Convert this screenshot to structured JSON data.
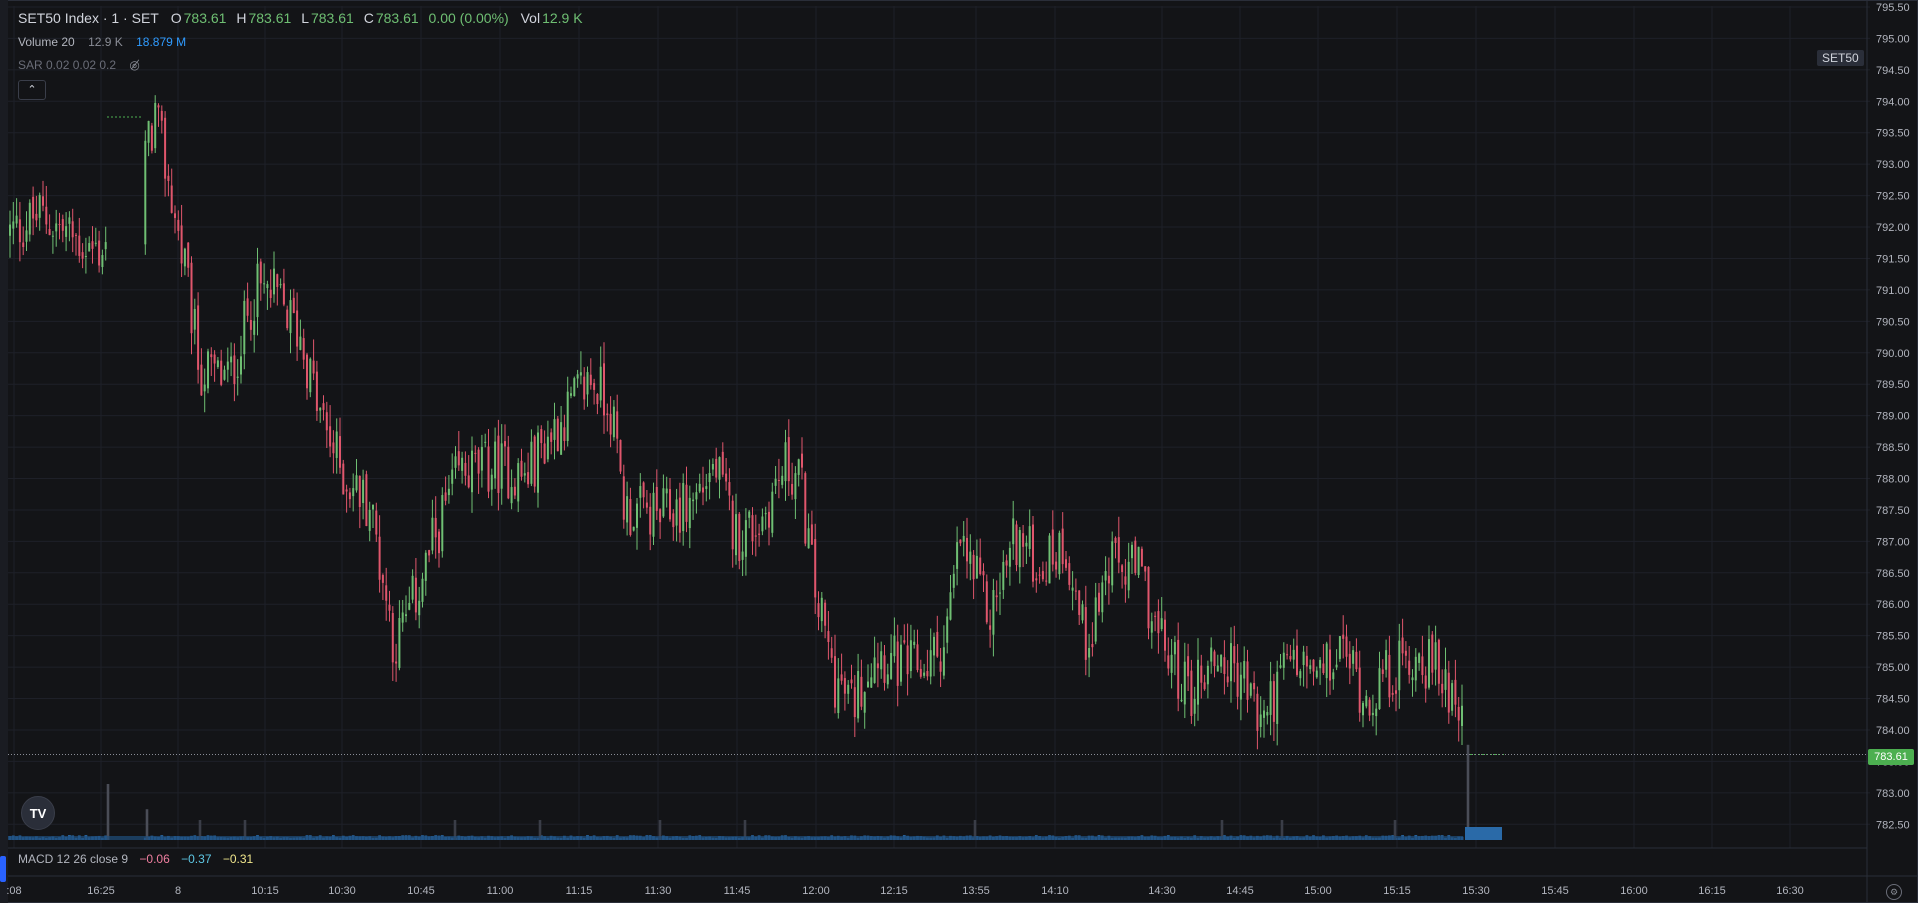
{
  "header": {
    "symbol": "SET50 Index · 1 · SET",
    "open_label": "O",
    "open": "783.61",
    "high_label": "H",
    "high": "783.61",
    "low_label": "L",
    "low": "783.61",
    "close_label": "C",
    "close": "783.61",
    "change": "0.00 (0.00%)",
    "vol_label": "Vol",
    "vol": "12.9 K"
  },
  "volume_legend": {
    "label": "Volume 20",
    "value": "12.9 K",
    "sma": "18.879 M"
  },
  "sar_legend": {
    "label": "SAR 0.02 0.02 0.2"
  },
  "macd_legend": {
    "label": "MACD 12 26 close 9",
    "macd": "−0.06",
    "signal": "−0.37",
    "hist": "−0.31"
  },
  "symbol_tag": "SET50",
  "last_price": "783.61",
  "icons": {
    "collapse": "chevron-up-icon",
    "logo": "tradingview-logo-icon",
    "eye": "eye-off-icon",
    "settings": "settings-icon"
  },
  "colors": {
    "up": "#6fbf73",
    "down": "#e0566c",
    "volume": "#2a6aa8",
    "sar": "#4caf50",
    "background": "#131417",
    "grid": "#1e2028"
  },
  "chart_data": {
    "type": "candlestick",
    "ylim": [
      782.25,
      795.5
    ],
    "y_ticks": [
      "795.50",
      "795.00",
      "794.50",
      "794.00",
      "793.50",
      "793.00",
      "792.50",
      "792.00",
      "791.50",
      "791.00",
      "790.50",
      "790.00",
      "789.50",
      "789.00",
      "788.50",
      "788.00",
      "787.50",
      "787.00",
      "786.50",
      "786.00",
      "785.50",
      "785.00",
      "784.50",
      "784.00",
      "783.50",
      "783.00",
      "782.50"
    ],
    "x_ticks": [
      ":08",
      "16:25",
      "8",
      "10:15",
      "10:30",
      "10:45",
      "11:00",
      "11:15",
      "11:30",
      "11:45",
      "12:00",
      "12:15",
      "13:55",
      "14:10",
      "14:30",
      "14:45",
      "15:00",
      "15:15",
      "15:30",
      "15:45",
      "16:00",
      "16:15",
      "16:30"
    ],
    "key_path": [
      [
        0,
        791.8
      ],
      [
        40,
        792.2
      ],
      [
        95,
        791.6
      ],
      [
        130,
        792.0
      ],
      [
        155,
        793.8
      ],
      [
        165,
        793.0
      ],
      [
        185,
        791.3
      ],
      [
        200,
        789.7
      ],
      [
        230,
        789.6
      ],
      [
        255,
        791.0
      ],
      [
        275,
        790.9
      ],
      [
        300,
        790.3
      ],
      [
        320,
        789.0
      ],
      [
        345,
        788.0
      ],
      [
        370,
        787.6
      ],
      [
        395,
        785.3
      ],
      [
        415,
        786.1
      ],
      [
        440,
        787.3
      ],
      [
        460,
        788.1
      ],
      [
        500,
        788.2
      ],
      [
        525,
        788.0
      ],
      [
        545,
        788.6
      ],
      [
        565,
        789.0
      ],
      [
        590,
        789.6
      ],
      [
        610,
        789.2
      ],
      [
        625,
        787.5
      ],
      [
        660,
        787.4
      ],
      [
        690,
        787.6
      ],
      [
        715,
        788.2
      ],
      [
        735,
        787.1
      ],
      [
        760,
        787.3
      ],
      [
        785,
        788.2
      ],
      [
        800,
        788.0
      ],
      [
        815,
        786.2
      ],
      [
        835,
        784.8
      ],
      [
        852,
        784.4
      ],
      [
        875,
        785.3
      ],
      [
        900,
        785.0
      ],
      [
        925,
        785.0
      ],
      [
        945,
        785.4
      ],
      [
        960,
        787.0
      ],
      [
        990,
        785.8
      ],
      [
        1015,
        787.1
      ],
      [
        1040,
        786.6
      ],
      [
        1065,
        787.0
      ],
      [
        1085,
        785.4
      ],
      [
        1110,
        786.6
      ],
      [
        1140,
        786.5
      ],
      [
        1160,
        785.4
      ],
      [
        1190,
        784.6
      ],
      [
        1215,
        785.2
      ],
      [
        1245,
        784.8
      ],
      [
        1260,
        784.1
      ],
      [
        1290,
        785.1
      ],
      [
        1320,
        784.8
      ],
      [
        1345,
        785.3
      ],
      [
        1365,
        784.5
      ],
      [
        1390,
        784.9
      ],
      [
        1420,
        785.2
      ],
      [
        1445,
        784.8
      ],
      [
        1460,
        784.5
      ]
    ],
    "volume_spikes": [
      [
        108,
        4
      ],
      [
        147,
        2.2
      ],
      [
        1468,
        6.8
      ]
    ],
    "sar_segments": [
      [
        107,
        143,
        793.75
      ],
      [
        1470,
        1505,
        783.61
      ]
    ],
    "last_price": 783.61
  }
}
